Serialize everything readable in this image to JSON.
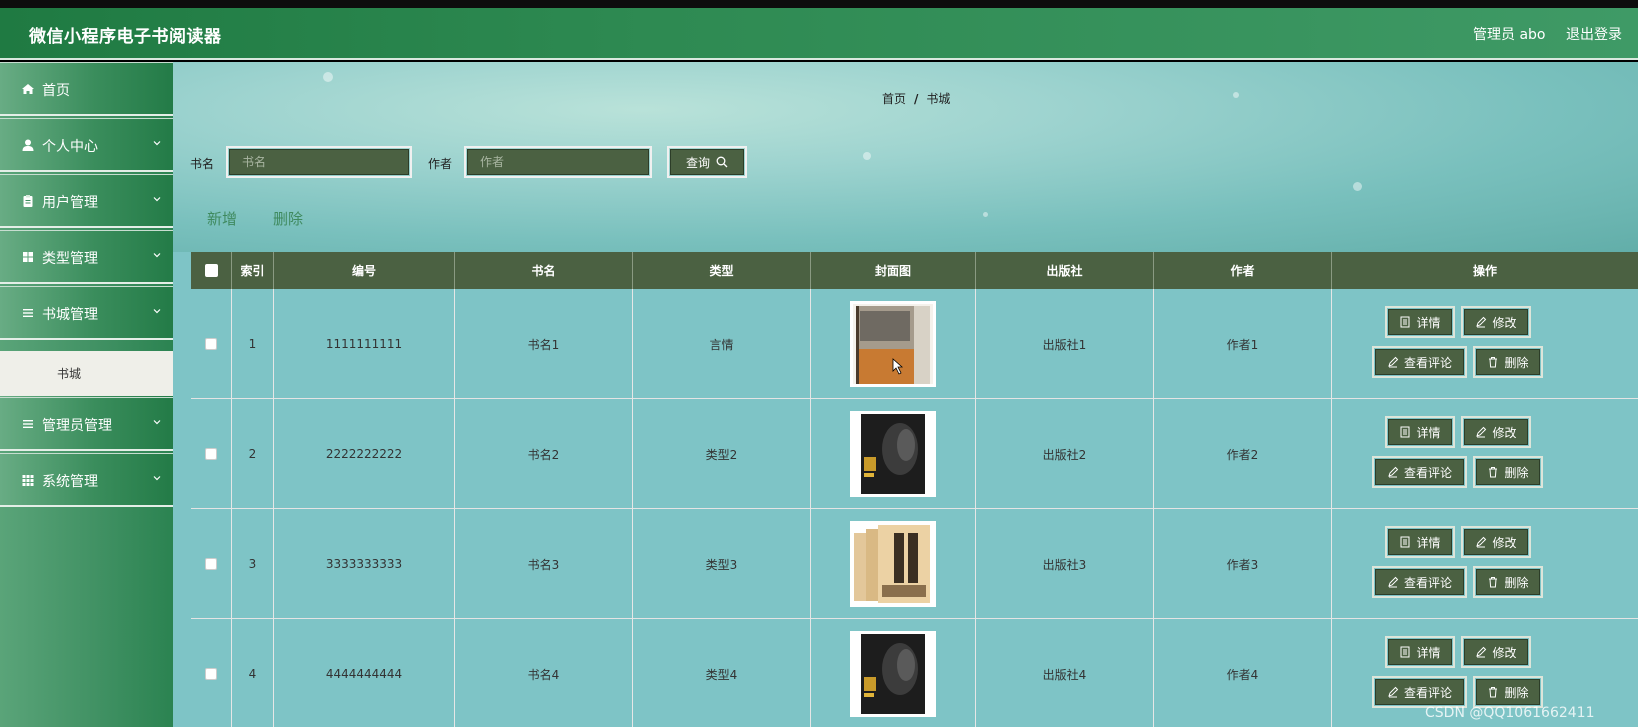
{
  "app": {
    "title": "微信小程序电子书阅读器",
    "user_label": "管理员 abo",
    "logout_label": "退出登录"
  },
  "sidebar": {
    "items": [
      {
        "label": "首页",
        "icon": "home-icon",
        "has_arrow": false
      },
      {
        "label": "个人中心",
        "icon": "user-icon",
        "has_arrow": true
      },
      {
        "label": "用户管理",
        "icon": "clipboard-icon",
        "has_arrow": true
      },
      {
        "label": "类型管理",
        "icon": "grid-icon",
        "has_arrow": true
      },
      {
        "label": "书城管理",
        "icon": "list-icon",
        "has_arrow": true
      },
      {
        "label": "管理员管理",
        "icon": "list-icon",
        "has_arrow": true
      },
      {
        "label": "系统管理",
        "icon": "apps-icon",
        "has_arrow": true
      }
    ],
    "sub_item": "书城"
  },
  "breadcrumb": {
    "home": "首页",
    "sep": "/",
    "current": "书城"
  },
  "search": {
    "book_label": "书名",
    "book_placeholder": "书名",
    "author_label": "作者",
    "author_placeholder": "作者",
    "query_label": "查询"
  },
  "actions": {
    "add": "新增",
    "delete": "删除"
  },
  "table": {
    "headers": [
      "索引",
      "编号",
      "书名",
      "类型",
      "封面图",
      "出版社",
      "作者",
      "操作"
    ],
    "rows": [
      {
        "index": "1",
        "code": "1111111111",
        "name": "书名1",
        "type": "言情",
        "publisher": "出版社1",
        "author": "作者1"
      },
      {
        "index": "2",
        "code": "2222222222",
        "name": "书名2",
        "type": "类型2",
        "publisher": "出版社2",
        "author": "作者2"
      },
      {
        "index": "3",
        "code": "3333333333",
        "name": "书名3",
        "type": "类型3",
        "publisher": "出版社3",
        "author": "作者3"
      },
      {
        "index": "4",
        "code": "4444444444",
        "name": "书名4",
        "type": "类型4",
        "publisher": "出版社4",
        "author": "作者4"
      }
    ],
    "op_labels": {
      "detail": "详情",
      "edit": "修改",
      "comments": "查看评论",
      "delete": "删除"
    }
  },
  "watermark": "CSDN @QQ1061662411",
  "colors": {
    "header_green": "#2e8a52",
    "button_dark": "#4b6142",
    "link_green": "#3f8a5f"
  }
}
